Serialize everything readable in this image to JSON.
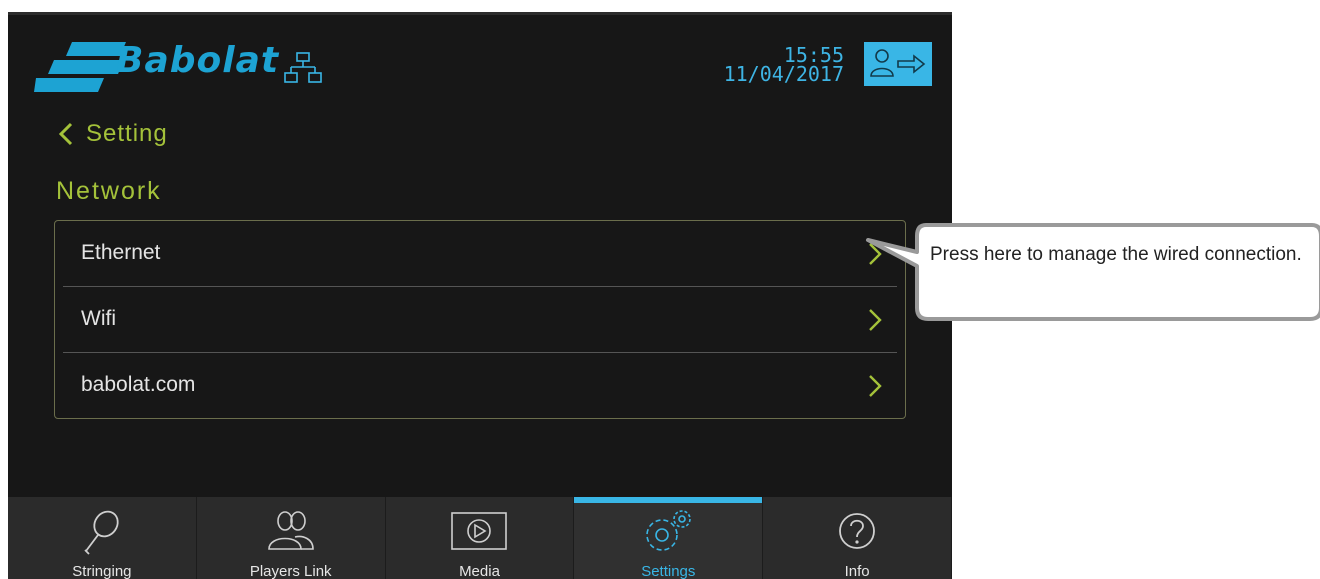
{
  "header": {
    "brand": "Babolat",
    "time": "15:55",
    "date": "11/04/2017",
    "icons": {
      "network": "network-icon",
      "logout": "logout-icon"
    }
  },
  "page": {
    "back_label": "Setting",
    "section_title": "Network"
  },
  "menu": {
    "items": [
      {
        "label": "Ethernet"
      },
      {
        "label": "Wifi"
      },
      {
        "label": "babolat.com"
      }
    ]
  },
  "tabs": [
    {
      "label": "Stringing",
      "icon": "racket-icon"
    },
    {
      "label": "Players Link",
      "icon": "users-icon"
    },
    {
      "label": "Media",
      "icon": "play-icon"
    },
    {
      "label": "Settings",
      "icon": "gears-icon",
      "active": true
    },
    {
      "label": "Info",
      "icon": "help-icon"
    }
  ],
  "callout": {
    "text": "Press here to manage the wired connection."
  },
  "colors": {
    "accent_blue": "#39b6e6",
    "accent_green": "#a4c23a",
    "background": "#171717"
  }
}
